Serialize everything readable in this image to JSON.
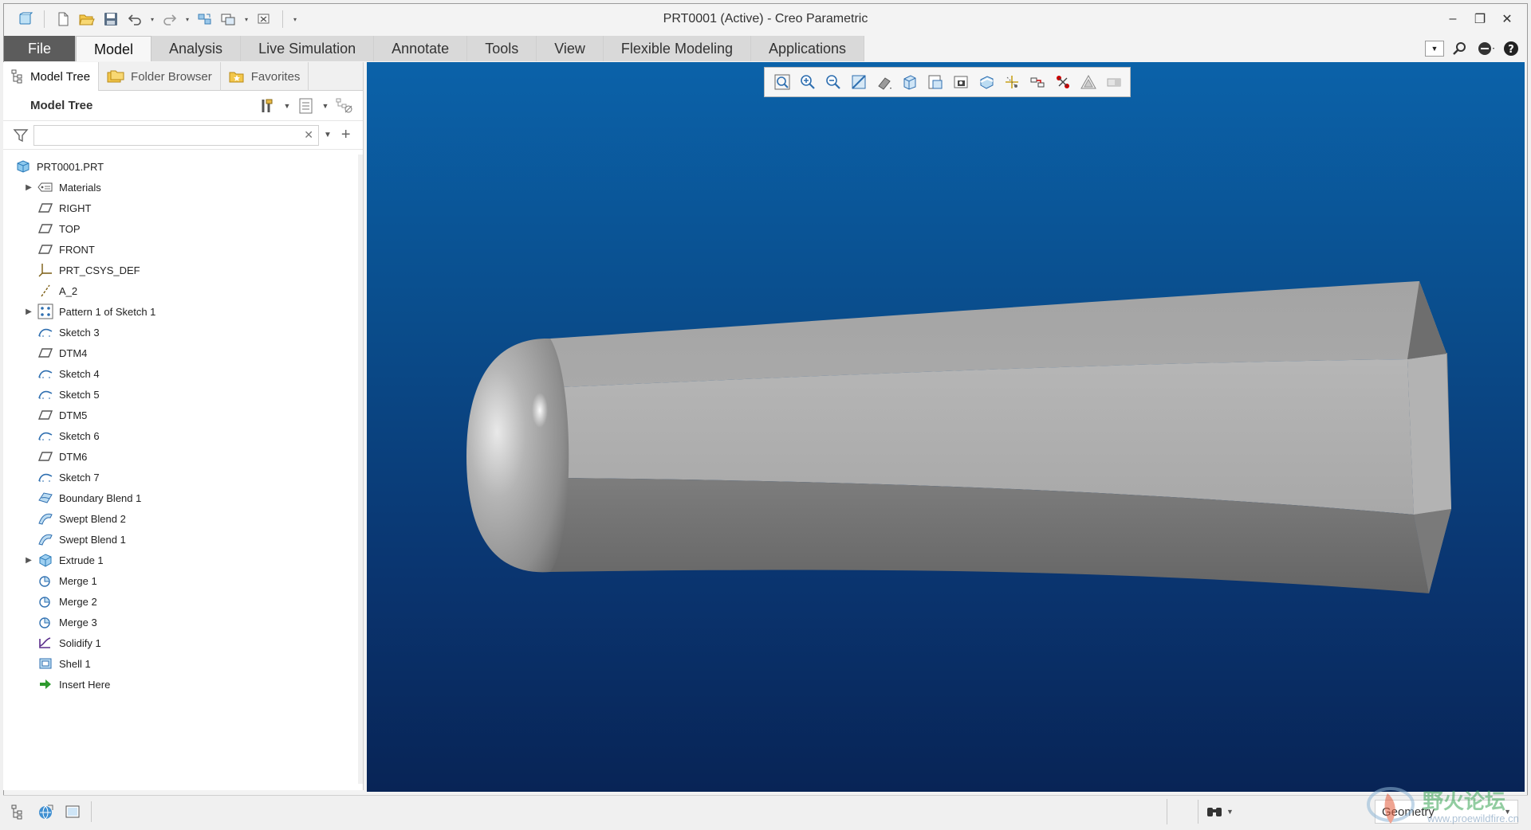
{
  "window": {
    "title": "PRT0001 (Active) - Creo Parametric",
    "controls": [
      "minimize",
      "maximize",
      "close"
    ]
  },
  "quick_access": [
    "new-icon",
    "open-icon",
    "save-icon",
    "undo-icon",
    "redo-icon",
    "regenerate-icon",
    "windows-icon",
    "close-window-icon",
    "customize-icon"
  ],
  "ribbon": {
    "tabs": [
      {
        "label": "File"
      },
      {
        "label": "Model",
        "active": true
      },
      {
        "label": "Analysis"
      },
      {
        "label": "Live Simulation"
      },
      {
        "label": "Annotate"
      },
      {
        "label": "Tools"
      },
      {
        "label": "View"
      },
      {
        "label": "Flexible Modeling"
      },
      {
        "label": "Applications"
      }
    ],
    "right_icons": [
      "minimize-ribbon-icon",
      "search-icon",
      "community-icon",
      "help-icon"
    ]
  },
  "navigator": {
    "tabs": [
      {
        "label": "Model Tree",
        "active": true
      },
      {
        "label": "Folder Browser"
      },
      {
        "label": "Favorites"
      }
    ],
    "header": "Model Tree",
    "search": {
      "value": "",
      "placeholder": ""
    },
    "tree": [
      {
        "label": "PRT0001.PRT",
        "icon": "part-icon",
        "level": 0,
        "expandable": false
      },
      {
        "label": "Materials",
        "icon": "materials-icon",
        "level": 1,
        "expandable": true
      },
      {
        "label": "RIGHT",
        "icon": "datum-plane-icon",
        "level": 1,
        "expandable": false
      },
      {
        "label": "TOP",
        "icon": "datum-plane-icon",
        "level": 1,
        "expandable": false
      },
      {
        "label": "FRONT",
        "icon": "datum-plane-icon",
        "level": 1,
        "expandable": false
      },
      {
        "label": "PRT_CSYS_DEF",
        "icon": "csys-icon",
        "level": 1,
        "expandable": false
      },
      {
        "label": "A_2",
        "icon": "datum-axis-icon",
        "level": 1,
        "expandable": false
      },
      {
        "label": "Pattern 1 of Sketch 1",
        "icon": "pattern-icon",
        "level": 1,
        "expandable": true
      },
      {
        "label": "Sketch 3",
        "icon": "sketch-icon",
        "level": 1,
        "expandable": false
      },
      {
        "label": "DTM4",
        "icon": "datum-plane-icon",
        "level": 1,
        "expandable": false
      },
      {
        "label": "Sketch 4",
        "icon": "sketch-icon",
        "level": 1,
        "expandable": false
      },
      {
        "label": "Sketch 5",
        "icon": "sketch-icon",
        "level": 1,
        "expandable": false
      },
      {
        "label": "DTM5",
        "icon": "datum-plane-icon",
        "level": 1,
        "expandable": false
      },
      {
        "label": "Sketch 6",
        "icon": "sketch-icon",
        "level": 1,
        "expandable": false
      },
      {
        "label": "DTM6",
        "icon": "datum-plane-icon",
        "level": 1,
        "expandable": false
      },
      {
        "label": "Sketch 7",
        "icon": "sketch-icon",
        "level": 1,
        "expandable": false
      },
      {
        "label": "Boundary Blend 1",
        "icon": "boundary-blend-icon",
        "level": 1,
        "expandable": false
      },
      {
        "label": "Swept Blend 2",
        "icon": "swept-blend-icon",
        "level": 1,
        "expandable": false
      },
      {
        "label": "Swept Blend 1",
        "icon": "swept-blend-icon",
        "level": 1,
        "expandable": false
      },
      {
        "label": "Extrude 1",
        "icon": "extrude-icon",
        "level": 1,
        "expandable": true
      },
      {
        "label": "Merge 1",
        "icon": "merge-icon",
        "level": 1,
        "expandable": false
      },
      {
        "label": "Merge 2",
        "icon": "merge-icon",
        "level": 1,
        "expandable": false
      },
      {
        "label": "Merge 3",
        "icon": "merge-icon",
        "level": 1,
        "expandable": false
      },
      {
        "label": "Solidify 1",
        "icon": "solidify-icon",
        "level": 1,
        "expandable": false
      },
      {
        "label": "Shell 1",
        "icon": "shell-icon",
        "level": 1,
        "expandable": false
      },
      {
        "label": "Insert Here",
        "icon": "insert-here-icon",
        "level": 1,
        "expandable": false
      }
    ]
  },
  "graphics_toolbar": [
    "refit-icon",
    "zoom-in-icon",
    "zoom-out-icon",
    "repaint-icon",
    "display-style-icon",
    "saved-orientations-icon",
    "view-manager-icon",
    "perspective-icon",
    "section-icon",
    "datum-display-icon",
    "annotation-display-icon",
    "spin-center-icon",
    "appearance-icon",
    "hidden-icon"
  ],
  "status_bar": {
    "left_icons": [
      "show-navigator-icon",
      "show-browser-icon",
      "full-screen-icon"
    ],
    "selection_filter": "Geometry"
  },
  "watermark": {
    "text": "野火论坛",
    "url": "www.proewildfire.cn"
  },
  "colors": {
    "viewport_top": "#0b62a9",
    "viewport_bottom": "#082456",
    "model_gray": "#a9a9a9",
    "file_tab": "#5c5c5c"
  }
}
